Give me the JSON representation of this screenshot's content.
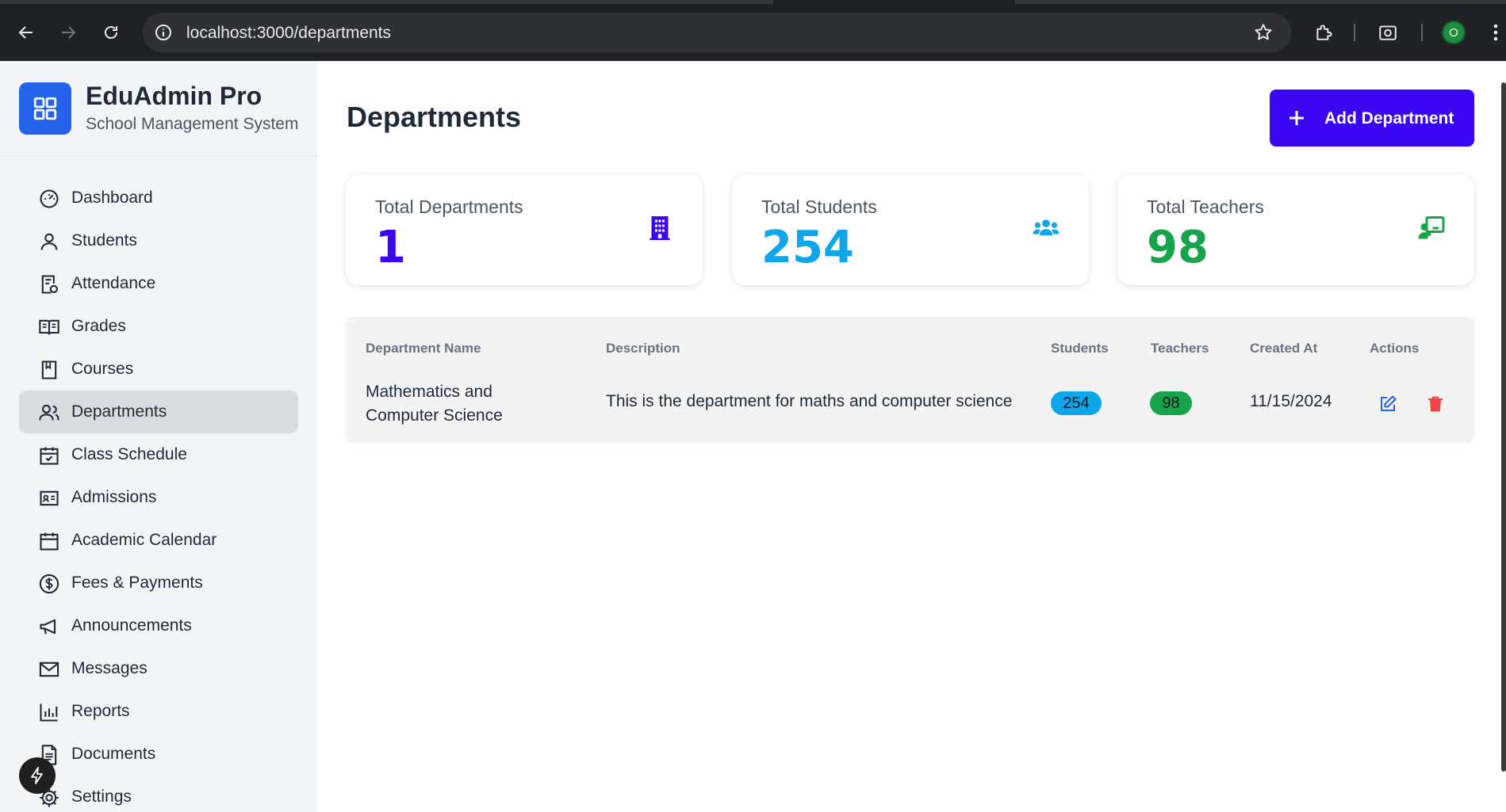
{
  "browser": {
    "url_host": "localhost",
    "url_path": ":3000/departments",
    "profile_initial": "O"
  },
  "brand": {
    "title": "EduAdmin Pro",
    "subtitle": "School Management System",
    "logo_icon": "grid-icon",
    "color": "#2563eb"
  },
  "sidebar": {
    "items": [
      {
        "label": "Dashboard",
        "icon": "speedometer-icon"
      },
      {
        "label": "Students",
        "icon": "user-icon"
      },
      {
        "label": "Attendance",
        "icon": "clipboard-icon"
      },
      {
        "label": "Grades",
        "icon": "book-open-icon"
      },
      {
        "label": "Courses",
        "icon": "bookmark-icon"
      },
      {
        "label": "Departments",
        "icon": "users-icon",
        "active": true
      },
      {
        "label": "Class Schedule",
        "icon": "calendar-check-icon"
      },
      {
        "label": "Admissions",
        "icon": "id-card-icon"
      },
      {
        "label": "Academic Calendar",
        "icon": "calendar-icon"
      },
      {
        "label": "Fees & Payments",
        "icon": "dollar-icon"
      },
      {
        "label": "Announcements",
        "icon": "megaphone-icon"
      },
      {
        "label": "Messages",
        "icon": "mail-icon"
      },
      {
        "label": "Reports",
        "icon": "bar-chart-icon"
      },
      {
        "label": "Documents",
        "icon": "file-icon"
      },
      {
        "label": "Settings",
        "icon": "gear-icon"
      }
    ]
  },
  "header": {
    "title": "Departments",
    "add_button": "Add Department",
    "add_button_color": "#3b07f2"
  },
  "stats": [
    {
      "label": "Total Departments",
      "value": "1",
      "color": "#3b07f2",
      "icon": "building-icon"
    },
    {
      "label": "Total Students",
      "value": "254",
      "color": "#0ea5e9",
      "icon": "group-icon"
    },
    {
      "label": "Total Teachers",
      "value": "98",
      "color": "#16a34a",
      "icon": "teacher-board-icon"
    }
  ],
  "table": {
    "headers": [
      "Department Name",
      "Description",
      "Students",
      "Teachers",
      "Created At",
      "Actions"
    ],
    "rows": [
      {
        "name_line1": "Mathematics and",
        "name_line2": "Computer Science",
        "description": "This is the department for maths and computer science",
        "students": "254",
        "teachers": "98",
        "created_at": "11/15/2024",
        "students_badge_color": "#0ea5e9",
        "teachers_badge_color": "#16a34a"
      }
    ]
  }
}
